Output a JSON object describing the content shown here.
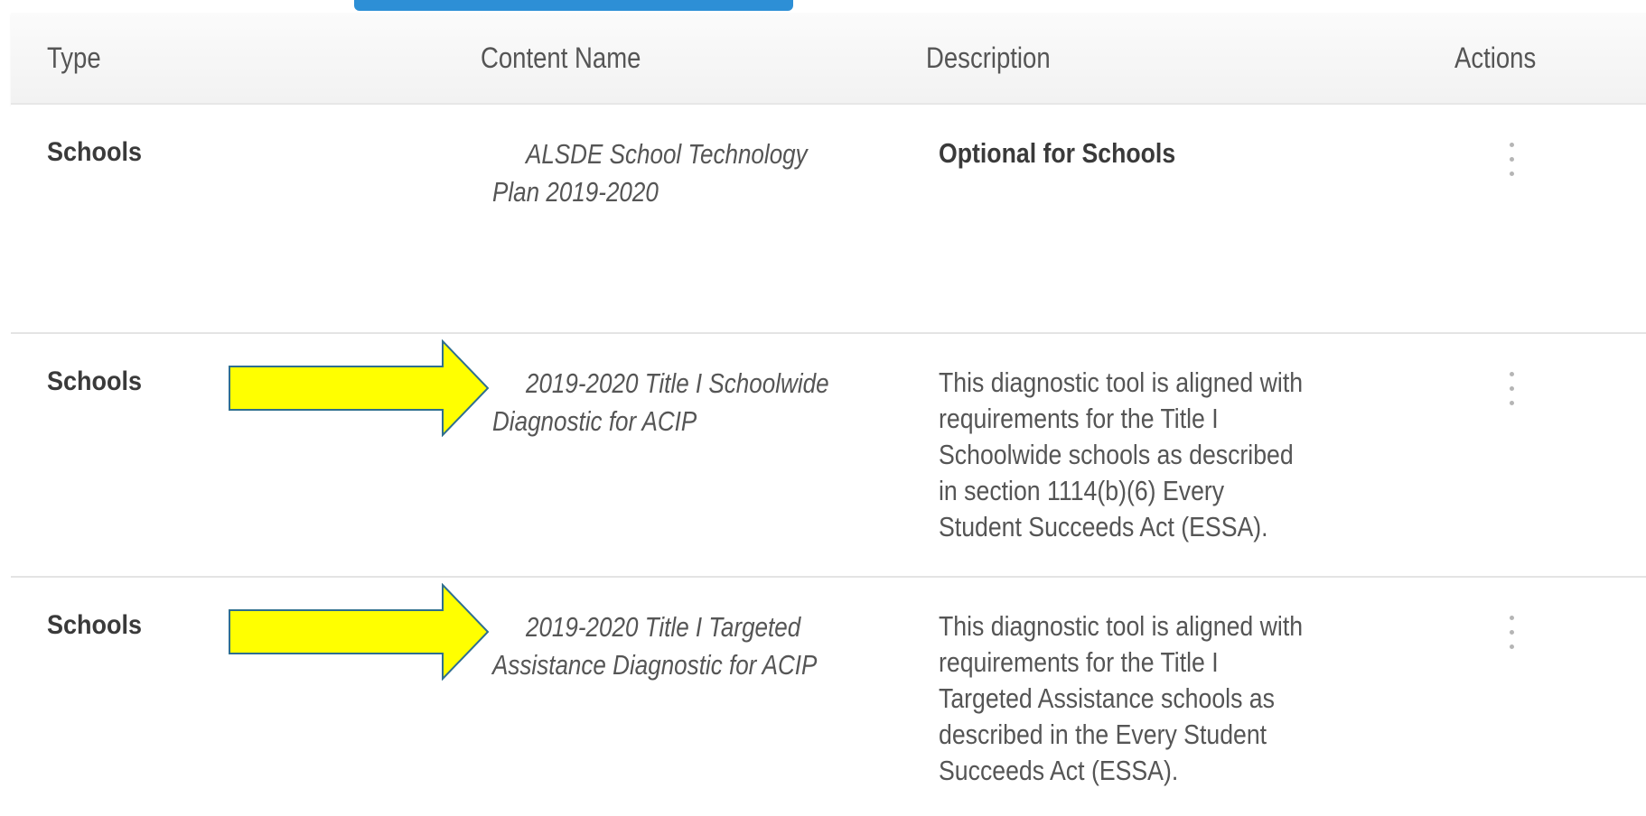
{
  "table": {
    "headers": {
      "type": "Type",
      "content_name": "Content Name",
      "description": "Description",
      "actions": "Actions"
    },
    "rows": [
      {
        "type": "Schools",
        "content_name": "ALSDE School Technology Plan 2019-2020",
        "description": "Optional for Schools"
      },
      {
        "type": "Schools",
        "content_name": "2019-2020 Title I Schoolwide Diagnostic for ACIP",
        "description": "This diagnostic tool is aligned with requirements for the Title I Schoolwide schools as described in section 1114(b)(6) Every Student Succeeds Act (ESSA)."
      },
      {
        "type": "Schools",
        "content_name": "2019-2020 Title I Targeted Assistance Diagnostic for ACIP",
        "description": "This diagnostic tool is aligned with requirements for the Title I Targeted Assistance schools as described in the Every Student Succeeds Act (ESSA)."
      }
    ]
  },
  "colors": {
    "tab_accent": "#2d8fd6",
    "arrow_fill": "#ffff00",
    "arrow_stroke": "#2f6f8f"
  },
  "icons": {
    "actions": "kebab-menu-icon",
    "highlight": "right-arrow-icon"
  }
}
